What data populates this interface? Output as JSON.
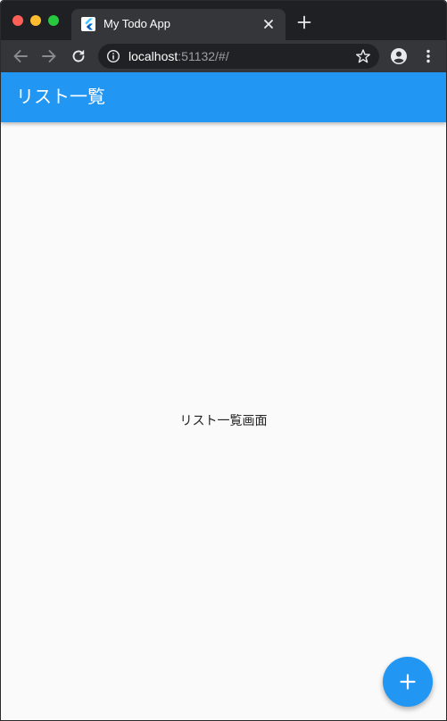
{
  "browser": {
    "tab": {
      "title": "My Todo App",
      "favicon": "flutter-icon"
    },
    "address_bar": {
      "host": "localhost",
      "rest": ":51132/#/"
    },
    "icons": {
      "back": "arrow-left-icon",
      "forward": "arrow-right-icon",
      "reload": "reload-icon",
      "info": "info-icon",
      "bookmark": "star-icon",
      "profile": "account-circle-icon",
      "menu": "more-vert-icon",
      "close_tab": "close-icon",
      "new_tab": "plus-icon"
    },
    "window_controls": {
      "close_color": "#fe5f57",
      "minimize_color": "#febc2e",
      "maximize_color": "#28c840"
    }
  },
  "app": {
    "appbar": {
      "title": "リスト一覧",
      "color": "#2196f3"
    },
    "body": {
      "text": "リスト一覧画面"
    },
    "fab": {
      "icon": "add-icon",
      "color": "#2196f3"
    }
  }
}
